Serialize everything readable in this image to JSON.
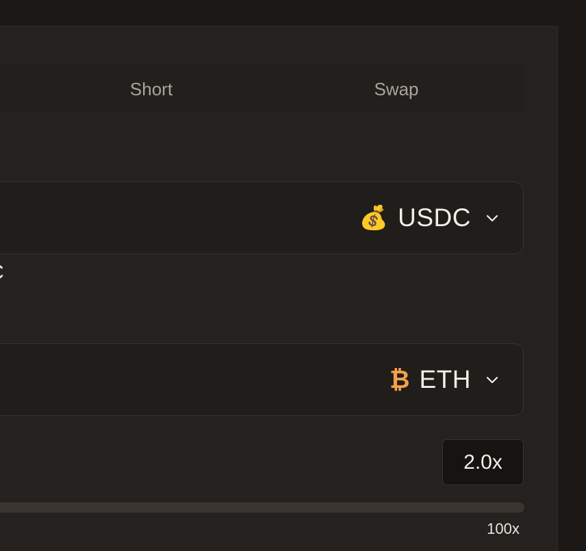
{
  "tabs": {
    "short_label": "Short",
    "swap_label": "Swap"
  },
  "pay": {
    "token_label": "USDC",
    "token_icon": "money-bag-icon",
    "partial_text": "C"
  },
  "receive": {
    "token_label": "ETH",
    "token_icon": "bitcoin-icon"
  },
  "leverage": {
    "value": "2.0x",
    "max_label": "100x",
    "slider_value": 2
  },
  "colors": {
    "panel": "#24211e",
    "text": "#f2efe9",
    "muted": "#a9a49c",
    "accent_orange": "#f2a14a",
    "track": "#3a3530"
  }
}
